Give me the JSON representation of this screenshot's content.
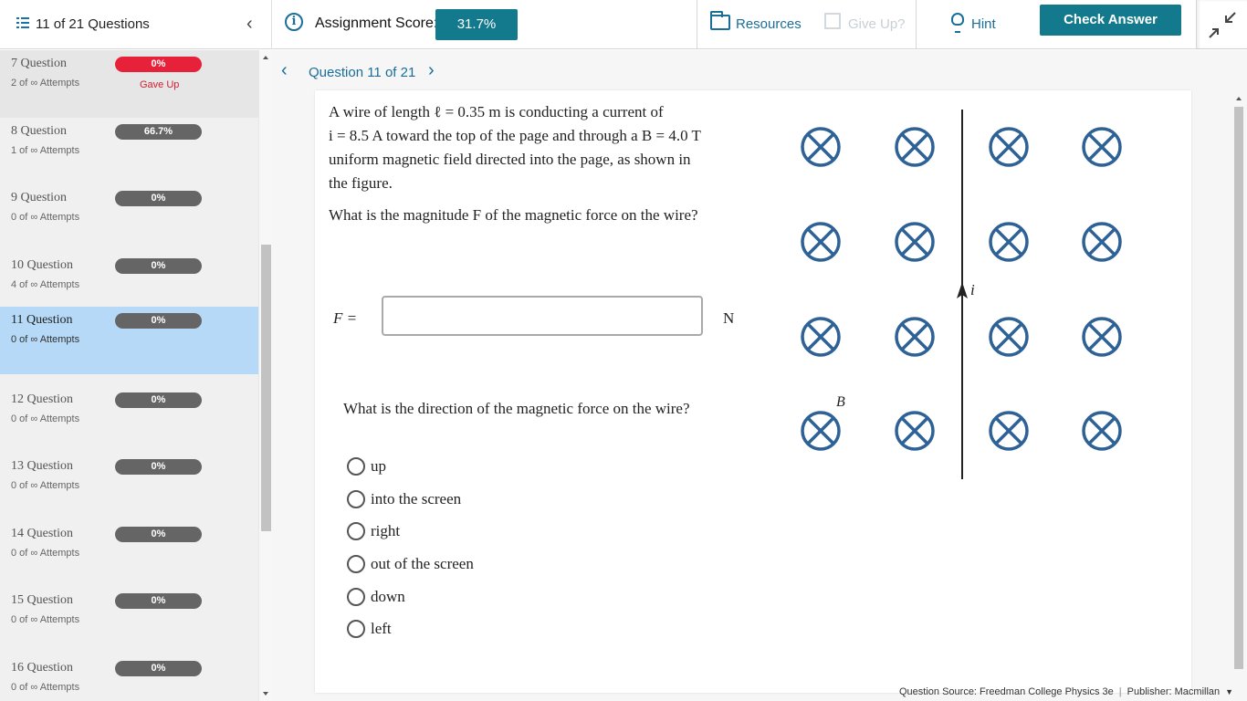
{
  "header": {
    "toc_title": "11 of 21 Questions",
    "score_label": "Assignment Score:",
    "score_value": "31.7%",
    "resources": "Resources",
    "give_up": "Give Up?",
    "hint": "Hint",
    "check_answer": "Check Answer"
  },
  "sidebar": {
    "items": [
      {
        "title": "7 Question",
        "attempts": "2 of ∞ Attempts",
        "score": "0%",
        "note": "Gave Up",
        "status": "gave-up"
      },
      {
        "title": "8 Question",
        "attempts": "1 of ∞ Attempts",
        "score": "66.7%",
        "note": "",
        "status": "normal"
      },
      {
        "title": "9 Question",
        "attempts": "0 of ∞ Attempts",
        "score": "0%",
        "note": "",
        "status": "normal"
      },
      {
        "title": "10 Question",
        "attempts": "4 of ∞ Attempts",
        "score": "0%",
        "note": "",
        "status": "normal"
      },
      {
        "title": "11 Question",
        "attempts": "0 of ∞ Attempts",
        "score": "0%",
        "note": "",
        "status": "active"
      },
      {
        "title": "12 Question",
        "attempts": "0 of ∞ Attempts",
        "score": "0%",
        "note": "",
        "status": "normal"
      },
      {
        "title": "13 Question",
        "attempts": "0 of ∞ Attempts",
        "score": "0%",
        "note": "",
        "status": "normal"
      },
      {
        "title": "14 Question",
        "attempts": "0 of ∞ Attempts",
        "score": "0%",
        "note": "",
        "status": "normal"
      },
      {
        "title": "15 Question",
        "attempts": "0 of ∞ Attempts",
        "score": "0%",
        "note": "",
        "status": "normal"
      },
      {
        "title": "16 Question",
        "attempts": "0 of ∞ Attempts",
        "score": "0%",
        "note": "",
        "status": "normal"
      }
    ]
  },
  "question": {
    "nav_label": "Question 11 of 21",
    "problem_l1": "A wire of length ℓ = 0.35 m is conducting a current of",
    "problem_l2": "i = 8.5 A toward the top of the page and through a B = 4.0 T",
    "problem_l3": "uniform magnetic field directed into the page, as shown in",
    "problem_l4": "the figure.",
    "q1": "What is the magnitude F of the magnetic force on the wire?",
    "answer_label": "F =",
    "answer_value": "",
    "unit": "N",
    "q2": "What is the direction of the magnetic force on the wire?",
    "options": [
      "up",
      "into the screen",
      "right",
      "out of the screen",
      "down",
      "left"
    ],
    "figure": {
      "current_label": "i",
      "field_label": "B"
    }
  },
  "footer": {
    "source": "Question Source: Freedman College Physics 3e",
    "publisher": "Publisher: Macmillan"
  },
  "colors": {
    "accent": "#137a8d",
    "link": "#1a6e99",
    "active_row": "#b5d9f7",
    "gave_up": "#e8213a",
    "field_symbol": "#2e6296"
  }
}
